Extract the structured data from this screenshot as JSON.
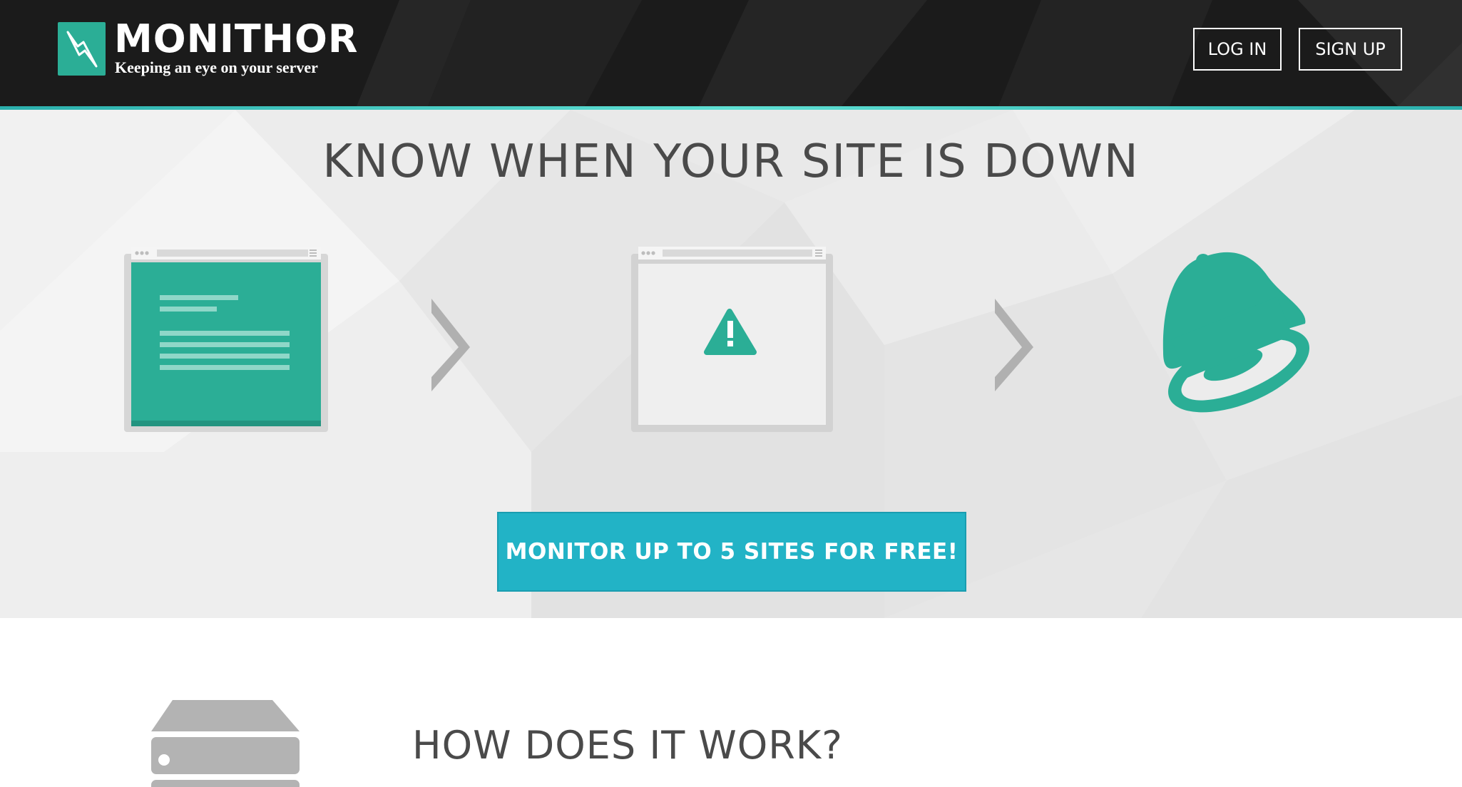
{
  "header": {
    "brand_name": "MONITHOR",
    "tagline": "Keeping an eye on your server",
    "login_label": "LOG IN",
    "signup_label": "SIGN UP",
    "logo_icon": "lightning-bolt-icon"
  },
  "hero": {
    "title": "KNOW WHEN YOUR SITE IS DOWN",
    "cta_label": "MONITOR UP TO 5 SITES FOR FREE!",
    "illustrations": [
      "website-page-icon",
      "chevron-right-icon",
      "broken-page-warning-icon",
      "chevron-right-icon",
      "bell-icon"
    ]
  },
  "how": {
    "title": "HOW DOES IT WORK?",
    "icon": "server-icon"
  },
  "colors": {
    "header_bg": "#1b1b1b",
    "accent_teal": "#2bae96",
    "cta_blue": "#22b3c6",
    "hero_bg": "#e8e8e8",
    "text_dark": "#4a4a4a"
  }
}
